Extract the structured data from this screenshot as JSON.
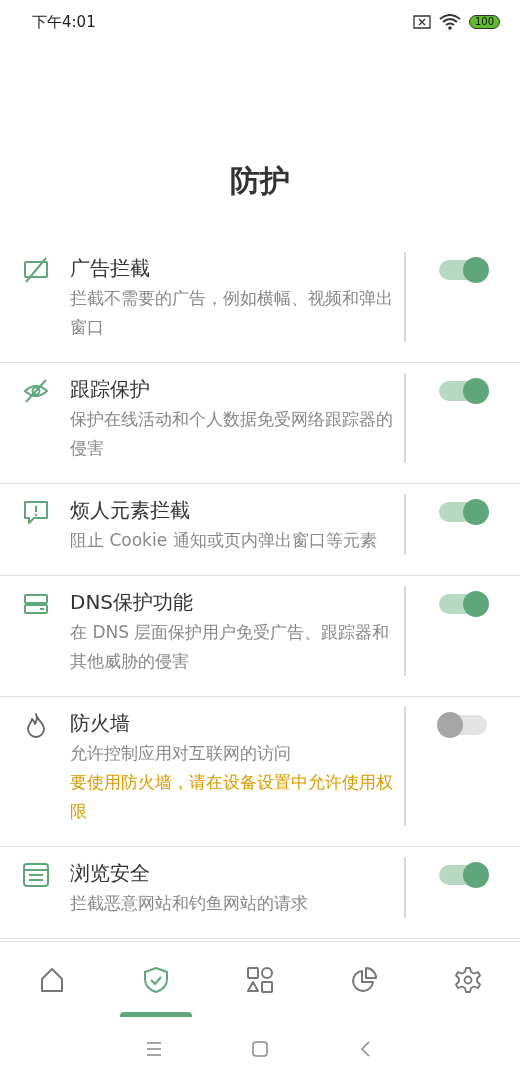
{
  "status_bar": {
    "time": "下午4:01",
    "battery": "100"
  },
  "title": "防护",
  "items": [
    {
      "title": "广告拦截",
      "description": "拦截不需要的广告，例如横幅、视频和弹出窗口",
      "on": true
    },
    {
      "title": "跟踪保护",
      "description": "保护在线活动和个人数据免受网络跟踪器的侵害",
      "on": true
    },
    {
      "title": "烦人元素拦截",
      "description": "阻止 Cookie 通知或页内弹出窗口等元素",
      "on": true
    },
    {
      "title": "DNS保护功能",
      "description": "在 DNS 层面保护用户免受广告、跟踪器和其他威胁的侵害",
      "on": true
    },
    {
      "title": "防火墙",
      "description": "允许控制应用对互联网的访问",
      "warning": "要使用防火墙，请在设备设置中允许使用权限",
      "on": false
    },
    {
      "title": "浏览安全",
      "description": "拦截恶意网站和钓鱼网站的请求",
      "on": true
    }
  ],
  "nav_tabs": [
    {
      "selected": false
    },
    {
      "selected": true
    },
    {
      "selected": false
    },
    {
      "selected": false
    },
    {
      "selected": false
    }
  ]
}
